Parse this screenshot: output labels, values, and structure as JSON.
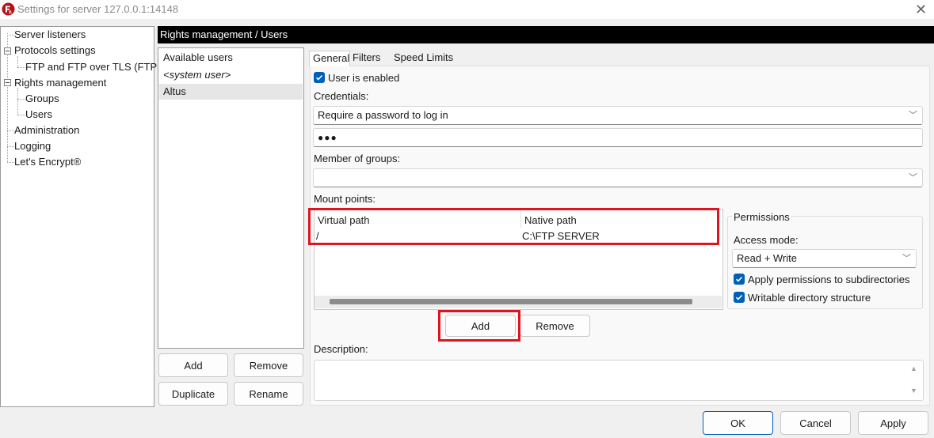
{
  "window": {
    "title": "Settings for server 127.0.0.1:14148",
    "close_glyph": "✕",
    "icon": "filezilla-icon"
  },
  "tree": {
    "items": [
      {
        "label": "Server listeners"
      },
      {
        "label": "Protocols settings"
      },
      {
        "label": "FTP and FTP over TLS (FTPS)"
      },
      {
        "label": "Rights management"
      },
      {
        "label": "Groups"
      },
      {
        "label": "Users"
      },
      {
        "label": "Administration"
      },
      {
        "label": "Logging"
      },
      {
        "label": "Let's Encrypt®"
      }
    ]
  },
  "section_header": "Rights management / Users",
  "users": {
    "header": "Available users",
    "items": [
      "<system user>",
      "Altus"
    ],
    "selected": "Altus",
    "buttons": {
      "add": "Add",
      "remove": "Remove",
      "duplicate": "Duplicate",
      "rename": "Rename"
    }
  },
  "tabs": [
    "General",
    "Filters",
    "Speed Limits"
  ],
  "active_tab": "General",
  "general": {
    "user_enabled_label": "User is enabled",
    "user_enabled": true,
    "credentials_label": "Credentials:",
    "credentials_value": "Require a password to log in",
    "password_value": "●●●",
    "member_of_groups_label": "Member of groups:",
    "member_of_groups_value": "",
    "mount_points_label": "Mount points:",
    "mount_columns": {
      "virtual": "Virtual path",
      "native": "Native path"
    },
    "mount_rows": [
      {
        "virtual": "/",
        "native": "C:\\FTP SERVER"
      }
    ],
    "mount_buttons": {
      "add": "Add",
      "remove": "Remove"
    },
    "permissions": {
      "title": "Permissions",
      "access_mode_label": "Access mode:",
      "access_mode_value": "Read + Write",
      "apply_subdirs_label": "Apply permissions to subdirectories",
      "apply_subdirs": true,
      "writable_structure_label": "Writable directory structure",
      "writable_structure": true
    },
    "description_label": "Description:",
    "description_value": ""
  },
  "footer": {
    "ok": "OK",
    "cancel": "Cancel",
    "apply": "Apply"
  },
  "colors": {
    "accent": "#005fb8",
    "highlight": "#e0141e",
    "header_bg": "#000000"
  }
}
